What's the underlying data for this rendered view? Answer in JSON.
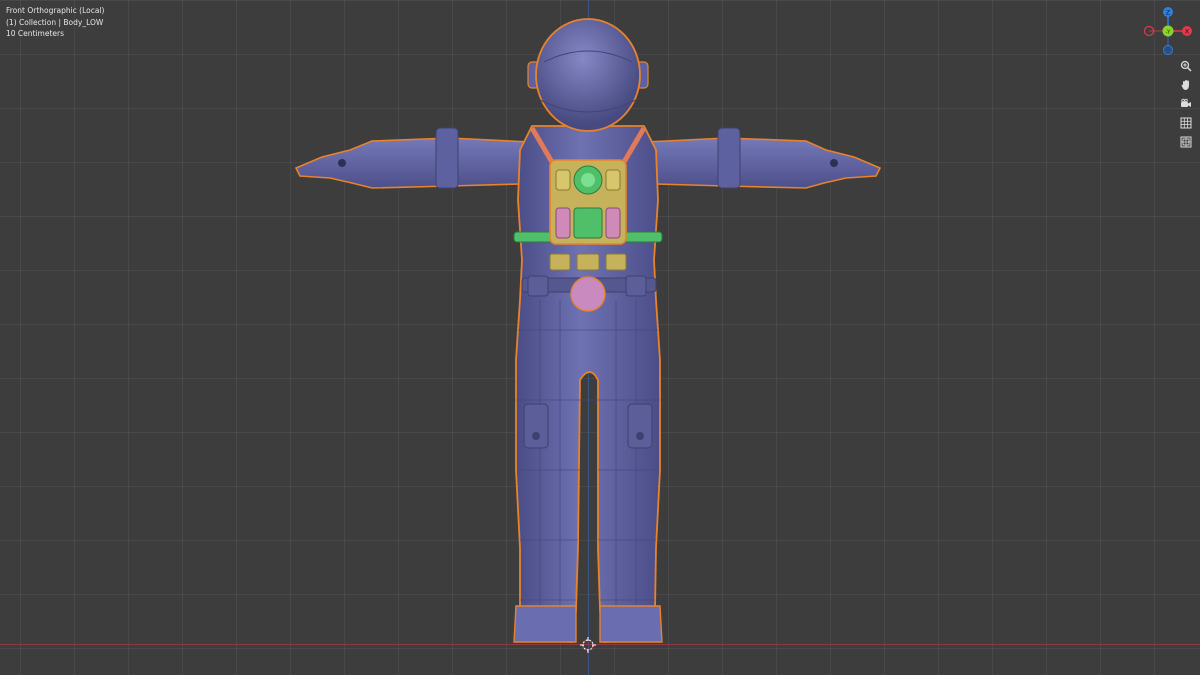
{
  "viewport": {
    "view_name": "Front Orthographic (Local)",
    "collection_info": "(1) Collection | Body_LOW",
    "grid_scale": "10 Centimeters"
  },
  "gizmo": {
    "z_label": "Z",
    "y_label": "-Y",
    "x_label": "X",
    "x_color": "#e2394d",
    "y_color": "#8bd327",
    "z_color": "#2f7fe0"
  },
  "nav_tools": [
    {
      "name": "zoom-icon",
      "glyph": "⌕"
    },
    {
      "name": "pan-hand-icon",
      "glyph": "✋"
    },
    {
      "name": "camera-view-icon",
      "glyph": "🎥"
    },
    {
      "name": "ortho-grid-icon",
      "glyph": "▦"
    },
    {
      "name": "local-view-icon",
      "glyph": "▣"
    }
  ],
  "colors": {
    "selection_outline": "#e8832b",
    "suit_base": "#5d5f9c",
    "gear_yellow": "#c6b25a",
    "gear_green": "#4fbf6a",
    "gear_pink": "#d08ab8"
  }
}
